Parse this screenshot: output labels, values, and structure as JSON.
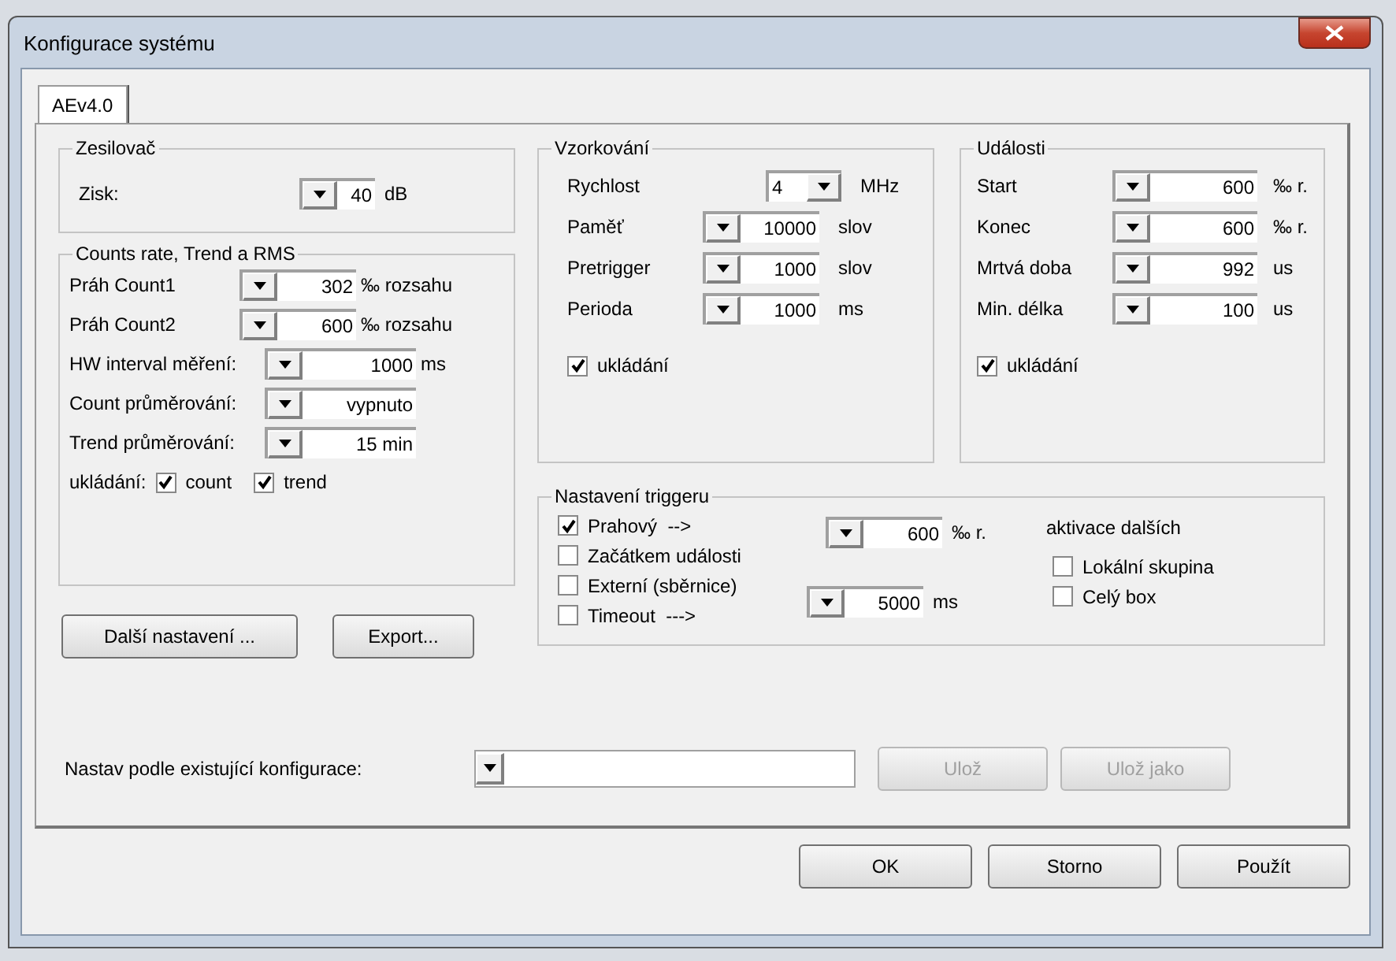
{
  "window": {
    "title": "Konfigurace systému"
  },
  "tabs": [
    {
      "label": "AEv4.0",
      "selected": true
    }
  ],
  "amplifier": {
    "title": "Zesilovač",
    "rows": [
      {
        "label": "Zisk:",
        "value": "40",
        "unit": "dB",
        "kind": "spin"
      }
    ]
  },
  "counts": {
    "title": "Counts rate, Trend a RMS",
    "rows": [
      {
        "label": "Práh Count1",
        "value": "302",
        "unit": "‰ rozsahu",
        "kind": "spin"
      },
      {
        "label": "Práh Count2",
        "value": "600",
        "unit": "‰ rozsahu",
        "kind": "spin"
      },
      {
        "label": "HW interval měření:",
        "value": "1000",
        "unit": "ms",
        "kind": "spin"
      },
      {
        "label": "Count průměrování:",
        "value": "vypnuto",
        "kind": "spin"
      },
      {
        "label": "Trend průměrování:",
        "value": "15 min",
        "kind": "spin"
      }
    ],
    "save_label": "ukládání:",
    "save_checks": [
      {
        "label": "count",
        "checked": true
      },
      {
        "label": "trend",
        "checked": true
      }
    ]
  },
  "left_buttons": [
    "Další nastavení ...",
    "Export..."
  ],
  "sampling": {
    "title": "Vzorkování",
    "rows": [
      {
        "label": "Rychlost",
        "value": "4",
        "unit": "MHz",
        "kind": "select"
      },
      {
        "label": "Paměť",
        "value": "10000",
        "unit": "slov",
        "kind": "spin"
      },
      {
        "label": "Pretrigger",
        "value": "1000",
        "unit": "slov",
        "kind": "spin"
      },
      {
        "label": "Perioda",
        "value": "1000",
        "unit": "ms",
        "kind": "spin"
      }
    ],
    "save": {
      "label": "ukládání",
      "checked": true
    }
  },
  "events": {
    "title": "Události",
    "rows": [
      {
        "label": "Start",
        "value": "600",
        "unit": "‰ r.",
        "kind": "spin"
      },
      {
        "label": "Konec",
        "value": "600",
        "unit": "‰ r.",
        "kind": "spin"
      },
      {
        "label": "Mrtvá doba",
        "value": "992",
        "unit": "us",
        "kind": "spin"
      },
      {
        "label": "Min. délka",
        "value": "100",
        "unit": "us",
        "kind": "spin"
      }
    ],
    "save": {
      "label": "ukládání",
      "checked": true
    }
  },
  "trigger": {
    "title": "Nastavení triggeru",
    "options": [
      {
        "label": "Prahový  -->",
        "checked": true
      },
      {
        "label": "Začátkem události",
        "checked": false
      },
      {
        "label": "Externí (sběrnice)",
        "checked": false
      },
      {
        "label": "Timeout  --->",
        "checked": false
      }
    ],
    "threshold": {
      "value": "600",
      "unit": "‰ r."
    },
    "timeout": {
      "value": "5000",
      "unit": "ms"
    },
    "activation_title": "aktivace dalších",
    "activation": [
      {
        "label": "Lokální skupina",
        "checked": false
      },
      {
        "label": "Celý box",
        "checked": false
      }
    ]
  },
  "preset": {
    "label": "Nastav podle existující konfigurace:",
    "buttons": [
      {
        "label": "Ulož",
        "disabled": true
      },
      {
        "label": "Ulož jako",
        "disabled": true
      }
    ]
  },
  "dialog_buttons": [
    {
      "label": "OK",
      "disabled": false
    },
    {
      "label": "Storno",
      "disabled": false
    },
    {
      "label": "Použít",
      "disabled": false
    }
  ]
}
